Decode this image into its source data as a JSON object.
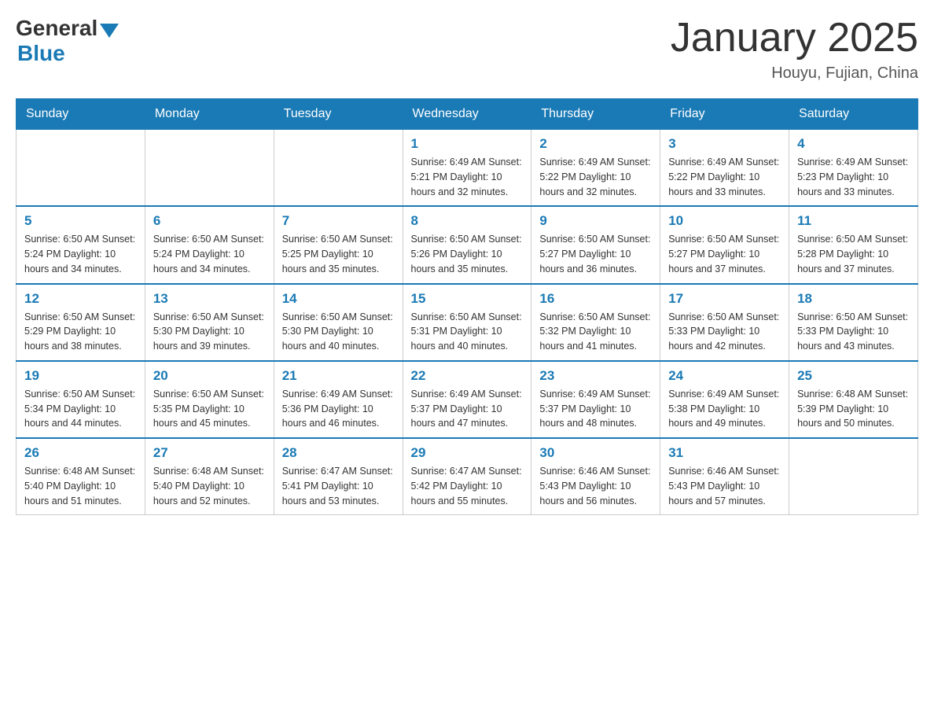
{
  "logo": {
    "general": "General",
    "blue": "Blue"
  },
  "title": "January 2025",
  "location": "Houyu, Fujian, China",
  "days_of_week": [
    "Sunday",
    "Monday",
    "Tuesday",
    "Wednesday",
    "Thursday",
    "Friday",
    "Saturday"
  ],
  "weeks": [
    [
      {
        "day": "",
        "info": ""
      },
      {
        "day": "",
        "info": ""
      },
      {
        "day": "",
        "info": ""
      },
      {
        "day": "1",
        "info": "Sunrise: 6:49 AM\nSunset: 5:21 PM\nDaylight: 10 hours\nand 32 minutes."
      },
      {
        "day": "2",
        "info": "Sunrise: 6:49 AM\nSunset: 5:22 PM\nDaylight: 10 hours\nand 32 minutes."
      },
      {
        "day": "3",
        "info": "Sunrise: 6:49 AM\nSunset: 5:22 PM\nDaylight: 10 hours\nand 33 minutes."
      },
      {
        "day": "4",
        "info": "Sunrise: 6:49 AM\nSunset: 5:23 PM\nDaylight: 10 hours\nand 33 minutes."
      }
    ],
    [
      {
        "day": "5",
        "info": "Sunrise: 6:50 AM\nSunset: 5:24 PM\nDaylight: 10 hours\nand 34 minutes."
      },
      {
        "day": "6",
        "info": "Sunrise: 6:50 AM\nSunset: 5:24 PM\nDaylight: 10 hours\nand 34 minutes."
      },
      {
        "day": "7",
        "info": "Sunrise: 6:50 AM\nSunset: 5:25 PM\nDaylight: 10 hours\nand 35 minutes."
      },
      {
        "day": "8",
        "info": "Sunrise: 6:50 AM\nSunset: 5:26 PM\nDaylight: 10 hours\nand 35 minutes."
      },
      {
        "day": "9",
        "info": "Sunrise: 6:50 AM\nSunset: 5:27 PM\nDaylight: 10 hours\nand 36 minutes."
      },
      {
        "day": "10",
        "info": "Sunrise: 6:50 AM\nSunset: 5:27 PM\nDaylight: 10 hours\nand 37 minutes."
      },
      {
        "day": "11",
        "info": "Sunrise: 6:50 AM\nSunset: 5:28 PM\nDaylight: 10 hours\nand 37 minutes."
      }
    ],
    [
      {
        "day": "12",
        "info": "Sunrise: 6:50 AM\nSunset: 5:29 PM\nDaylight: 10 hours\nand 38 minutes."
      },
      {
        "day": "13",
        "info": "Sunrise: 6:50 AM\nSunset: 5:30 PM\nDaylight: 10 hours\nand 39 minutes."
      },
      {
        "day": "14",
        "info": "Sunrise: 6:50 AM\nSunset: 5:30 PM\nDaylight: 10 hours\nand 40 minutes."
      },
      {
        "day": "15",
        "info": "Sunrise: 6:50 AM\nSunset: 5:31 PM\nDaylight: 10 hours\nand 40 minutes."
      },
      {
        "day": "16",
        "info": "Sunrise: 6:50 AM\nSunset: 5:32 PM\nDaylight: 10 hours\nand 41 minutes."
      },
      {
        "day": "17",
        "info": "Sunrise: 6:50 AM\nSunset: 5:33 PM\nDaylight: 10 hours\nand 42 minutes."
      },
      {
        "day": "18",
        "info": "Sunrise: 6:50 AM\nSunset: 5:33 PM\nDaylight: 10 hours\nand 43 minutes."
      }
    ],
    [
      {
        "day": "19",
        "info": "Sunrise: 6:50 AM\nSunset: 5:34 PM\nDaylight: 10 hours\nand 44 minutes."
      },
      {
        "day": "20",
        "info": "Sunrise: 6:50 AM\nSunset: 5:35 PM\nDaylight: 10 hours\nand 45 minutes."
      },
      {
        "day": "21",
        "info": "Sunrise: 6:49 AM\nSunset: 5:36 PM\nDaylight: 10 hours\nand 46 minutes."
      },
      {
        "day": "22",
        "info": "Sunrise: 6:49 AM\nSunset: 5:37 PM\nDaylight: 10 hours\nand 47 minutes."
      },
      {
        "day": "23",
        "info": "Sunrise: 6:49 AM\nSunset: 5:37 PM\nDaylight: 10 hours\nand 48 minutes."
      },
      {
        "day": "24",
        "info": "Sunrise: 6:49 AM\nSunset: 5:38 PM\nDaylight: 10 hours\nand 49 minutes."
      },
      {
        "day": "25",
        "info": "Sunrise: 6:48 AM\nSunset: 5:39 PM\nDaylight: 10 hours\nand 50 minutes."
      }
    ],
    [
      {
        "day": "26",
        "info": "Sunrise: 6:48 AM\nSunset: 5:40 PM\nDaylight: 10 hours\nand 51 minutes."
      },
      {
        "day": "27",
        "info": "Sunrise: 6:48 AM\nSunset: 5:40 PM\nDaylight: 10 hours\nand 52 minutes."
      },
      {
        "day": "28",
        "info": "Sunrise: 6:47 AM\nSunset: 5:41 PM\nDaylight: 10 hours\nand 53 minutes."
      },
      {
        "day": "29",
        "info": "Sunrise: 6:47 AM\nSunset: 5:42 PM\nDaylight: 10 hours\nand 55 minutes."
      },
      {
        "day": "30",
        "info": "Sunrise: 6:46 AM\nSunset: 5:43 PM\nDaylight: 10 hours\nand 56 minutes."
      },
      {
        "day": "31",
        "info": "Sunrise: 6:46 AM\nSunset: 5:43 PM\nDaylight: 10 hours\nand 57 minutes."
      },
      {
        "day": "",
        "info": ""
      }
    ]
  ]
}
